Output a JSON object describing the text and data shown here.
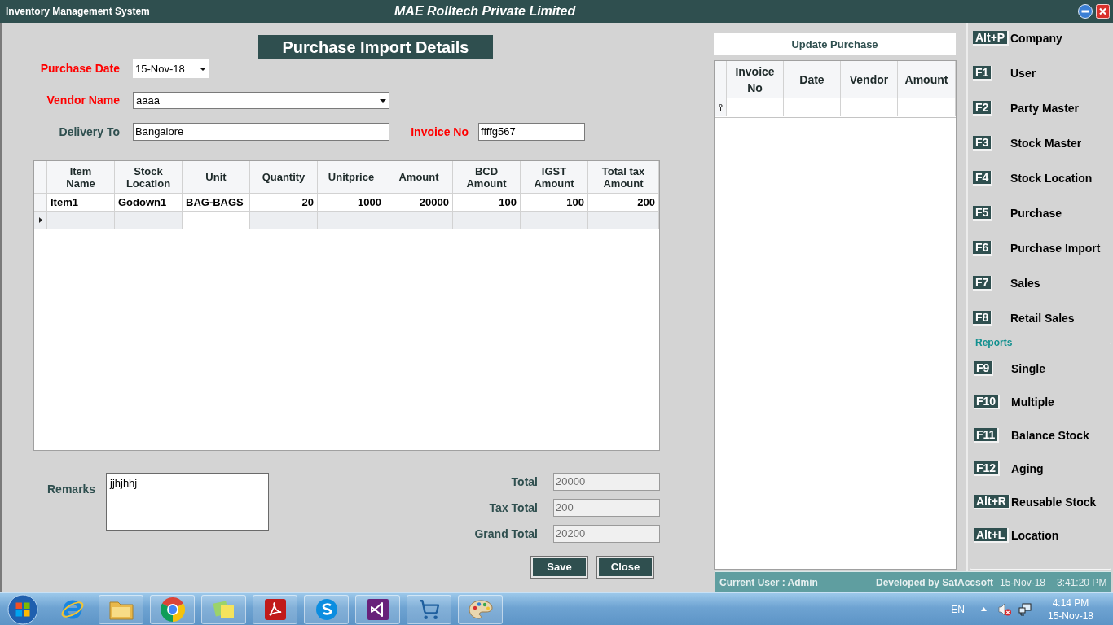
{
  "window": {
    "title": "Inventory Management System",
    "company": "MAE Rolltech Private Limited"
  },
  "form": {
    "heading": "Purchase Import Details",
    "rows": [
      {
        "fields": [
          {
            "label": "Purchase Date",
            "color": "#ff0000",
            "kind": "date",
            "value": "15-Nov-18"
          }
        ]
      },
      {
        "fields": [
          {
            "label": "Vendor Name",
            "color": "#ff0000",
            "kind": "combo",
            "value": "aaaa"
          }
        ]
      },
      {
        "fields": [
          {
            "label": "Delivery To",
            "color": "#2f4f4f",
            "kind": "text",
            "value": "Bangalore"
          },
          {
            "label": "Invoice No",
            "color": "#ff0000",
            "kind": "text",
            "value": "ffffg567"
          }
        ]
      }
    ]
  },
  "items_table": {
    "columns": [
      {
        "title": "Item Name",
        "kind": "text"
      },
      {
        "title": "Stock Location",
        "kind": "text"
      },
      {
        "title": "Unit",
        "kind": "text"
      },
      {
        "title": "Quantity",
        "kind": "number"
      },
      {
        "title": "Unitprice",
        "kind": "number"
      },
      {
        "title": "Amount",
        "kind": "number"
      },
      {
        "title": "BCD Amount",
        "kind": "number"
      },
      {
        "title": "IGST Amount",
        "kind": "number"
      },
      {
        "title": "Total tax Amount",
        "kind": "number"
      }
    ],
    "rows": [
      {
        "selected": false,
        "cells": [
          "Item1",
          "Godown1",
          "BAG-BAGS",
          "20",
          "1000",
          "20000",
          "100",
          "100",
          "200"
        ]
      },
      {
        "selected": true,
        "focused_cells": [
          false,
          false,
          true,
          false,
          false,
          false,
          false,
          false,
          false
        ]
      }
    ]
  },
  "remarks": {
    "label": "Remarks",
    "value": "jjhjhhj"
  },
  "totals": [
    {
      "label": "Total",
      "value": "20000",
      "read_only": true
    },
    {
      "label": "Tax Total",
      "value": "200",
      "read_only": true
    },
    {
      "label": "Grand Total",
      "value": "20200",
      "read_only": true
    }
  ],
  "buttons": [
    "Save",
    "Close"
  ],
  "update_purchase": {
    "title": "Update Purchase",
    "columns": [
      "Invoice No",
      "Date",
      "Vendor",
      "Amount"
    ]
  },
  "shortcuts": [
    {
      "key": "Alt+P",
      "label": "Company"
    },
    {
      "key": "F1",
      "label": "User"
    },
    {
      "key": "F2",
      "label": "Party Master"
    },
    {
      "key": "F3",
      "label": "Stock Master"
    },
    {
      "key": "F4",
      "label": "Stock Location"
    },
    {
      "key": "F5",
      "label": "Purchase"
    },
    {
      "key": "F6",
      "label": "Purchase Import"
    },
    {
      "key": "F7",
      "label": "Sales"
    },
    {
      "key": "F8",
      "label": "Retail Sales"
    }
  ],
  "reports": {
    "title": "Reports",
    "items": [
      {
        "key": "F9",
        "label": "Single"
      },
      {
        "key": "F10",
        "label": "Multiple"
      },
      {
        "key": "F11",
        "label": "Balance Stock"
      },
      {
        "key": "F12",
        "label": "Aging"
      },
      {
        "key": "Alt+R",
        "label": "Reusable Stock"
      },
      {
        "key": "Alt+L",
        "label": "Location"
      }
    ]
  },
  "status_bar": {
    "user": "Current User : Admin",
    "developer": "Developed by SatAccsoft",
    "date": "15-Nov-18",
    "time": "3:41:20 PM"
  },
  "taskbar": {
    "language": "EN",
    "time": "4:14 PM",
    "date": "15-Nov-18"
  }
}
